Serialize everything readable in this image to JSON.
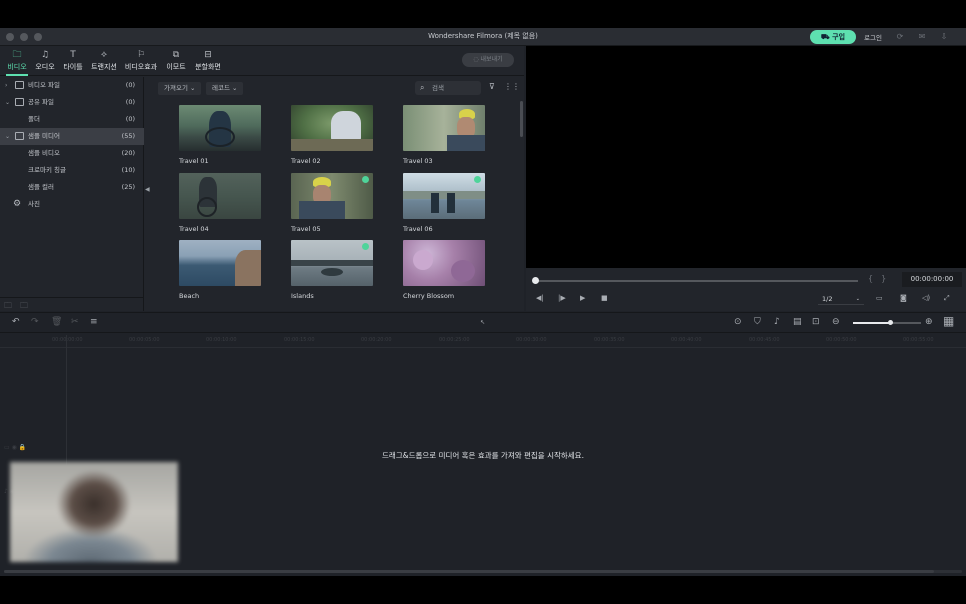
{
  "window": {
    "title": "Wondershare Filmora (제목 없음)",
    "buy_label": "구입",
    "login_label": "로그인"
  },
  "tabs": [
    {
      "label": "비디오",
      "icon": "folder-icon",
      "active": true
    },
    {
      "label": "오디오",
      "icon": "music-icon"
    },
    {
      "label": "타이틀",
      "icon": "text-icon"
    },
    {
      "label": "트랜지션",
      "icon": "transition-icon"
    },
    {
      "label": "비디오효과",
      "icon": "effects-icon"
    },
    {
      "label": "이모트",
      "icon": "elements-icon"
    },
    {
      "label": "분할화면",
      "icon": "split-screen-icon"
    }
  ],
  "export_label": "내보내기",
  "sidebar": {
    "items": [
      {
        "label": "비디오 파일",
        "count": "(0)"
      },
      {
        "label": "공유 파일",
        "count": "(0)"
      },
      {
        "label": "폴더",
        "count": "(0)"
      },
      {
        "label": "샘플 미디어",
        "count": "(55)"
      },
      {
        "label": "샘플 비디오",
        "count": "(20)"
      },
      {
        "label": "크로마키 칭글",
        "count": "(10)"
      },
      {
        "label": "샘플 컬러",
        "count": "(25)"
      },
      {
        "label": "사진",
        "count": ""
      }
    ]
  },
  "toolbar": {
    "import_label": "가져오기",
    "record_label": "레코드",
    "search_placeholder": "검색"
  },
  "media": [
    {
      "title": "Travel 01"
    },
    {
      "title": "Travel 02"
    },
    {
      "title": "Travel 03"
    },
    {
      "title": "Travel 04"
    },
    {
      "title": "Travel 05"
    },
    {
      "title": "Travel 06"
    },
    {
      "title": "Beach"
    },
    {
      "title": "Islands"
    },
    {
      "title": "Cherry Blossom"
    }
  ],
  "preview": {
    "timecode": "00:00:00:00",
    "ratio": "1/2"
  },
  "timeline": {
    "drop_message": "드래그&드롭으로 미디어 혹은 효과를 가져와 편집을 시작하세요.",
    "ruler": [
      "00:00:00:00",
      "00:00:05:00",
      "00:00:10:00",
      "00:00:15:00",
      "00:00:20:00",
      "00:00:25:00",
      "00:00:30:00",
      "00:00:35:00",
      "00:00:40:00",
      "00:00:45:00",
      "00:00:50:00",
      "00:00:55:00"
    ],
    "zoom_level": 0.55
  },
  "colors": {
    "accent": "#5ee0b0",
    "panel": "#22252b",
    "background": "#1f2228"
  }
}
